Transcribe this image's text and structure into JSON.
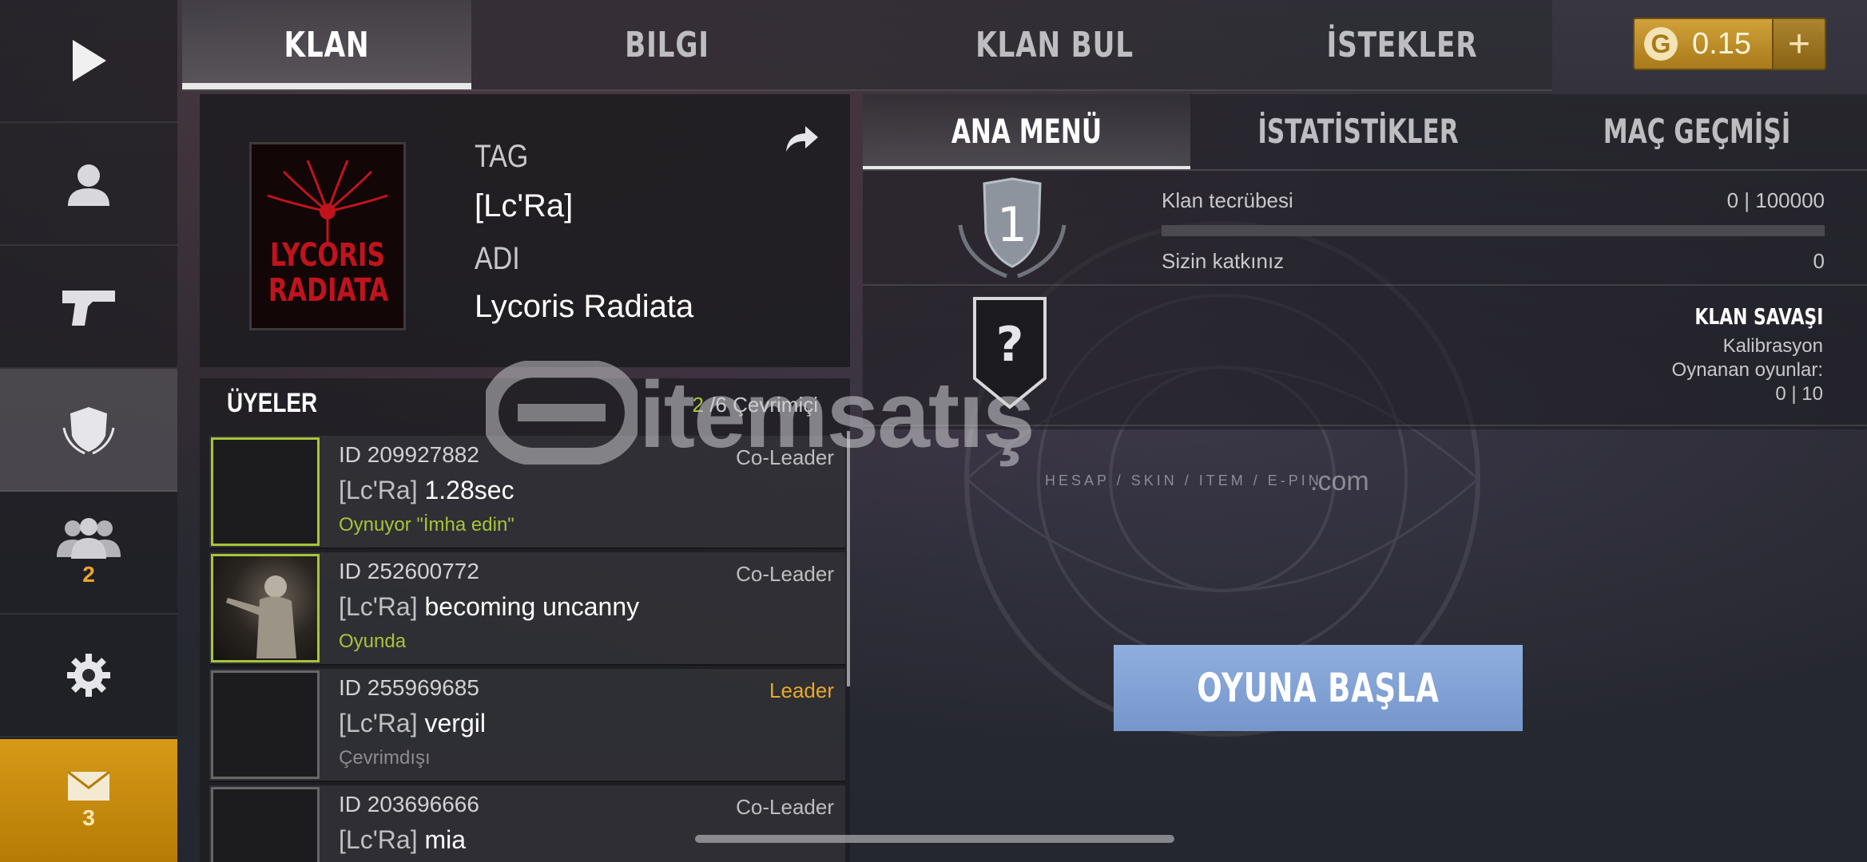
{
  "sidebar": {
    "items": [
      {
        "icon": "play-icon"
      },
      {
        "icon": "profile-icon"
      },
      {
        "icon": "pistol-icon"
      },
      {
        "icon": "clan-shield-icon",
        "active": true
      },
      {
        "icon": "friends-icon",
        "badge": "2"
      },
      {
        "icon": "gear-icon"
      },
      {
        "icon": "mail-icon",
        "badge": "3"
      }
    ]
  },
  "top_tabs": [
    "KLAN",
    "BILGI",
    "KLAN BUL",
    "İSTEKLER"
  ],
  "currency": {
    "value": "0.15",
    "plus": "+",
    "icon_letter": "G"
  },
  "clan": {
    "tag_label": "TAG",
    "tag_value": "[Lc'Ra]",
    "name_label": "ADI",
    "name_value": "Lycoris Radiata",
    "logo_line1": "LYCORIS",
    "logo_line2": "RADIATA"
  },
  "members": {
    "title": "ÜYELER",
    "online": "2",
    "total_text": "/6 Çevrimiçi",
    "list": [
      {
        "id": "ID 209927882",
        "tag": "[Lc'Ra]",
        "name": "1.28sec",
        "role": "Co-Leader",
        "status": "Oynuyor \"İmha edin\"",
        "online": true
      },
      {
        "id": "ID 252600772",
        "tag": "[Lc'Ra]",
        "name": "becoming uncanny",
        "role": "Co-Leader",
        "status": "Oyunda",
        "online": true
      },
      {
        "id": "ID 255969685",
        "tag": "[Lc'Ra]",
        "name": "vergil",
        "role": "Leader",
        "status": "Çevrimdışı",
        "online": false
      },
      {
        "id": "ID 203696666",
        "tag": "[Lc'Ra]",
        "name": "mia",
        "role": "Co-Leader",
        "status": "",
        "online": false
      }
    ]
  },
  "sub_tabs": [
    "ANA MENÜ",
    "İSTATİSTİKLER",
    "MAÇ GEÇMİŞİ"
  ],
  "stats": {
    "level": "1",
    "xp_label": "Klan tecrübesi",
    "xp_value": "0 | 100000",
    "xp_progress": 0,
    "contrib_label": "Sizin katkınız",
    "contrib_value": "0"
  },
  "clan_war": {
    "badge": "?",
    "title": "KLAN SAVAŞI",
    "status": "Kalibrasyon",
    "played_label": "Oynanan oyunlar:",
    "played_value": "0 | 10"
  },
  "play_button": "OYUNA BAŞLA",
  "watermark": {
    "text": "itemsatış",
    "sub": "HESAP / SKIN / ITEM / E-PIN",
    "com": ".com"
  },
  "colors": {
    "accent_green": "#a8c43a",
    "gold": "#e8a82a",
    "play_blue": "#7f9fd6"
  }
}
